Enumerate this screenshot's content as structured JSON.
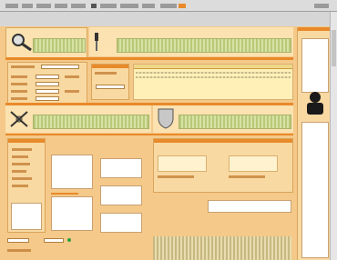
{
  "window": {
    "menu_items": [
      "",
      "",
      "",
      "",
      "",
      "",
      "",
      "",
      "",
      "",
      "",
      ""
    ]
  },
  "top_section": {
    "left_icon": "magnifier-icon",
    "right_icon": "tool-icon"
  },
  "middle_section": {
    "left_icon": "crossed-tools-icon",
    "right_icon": "shield-icon"
  },
  "right_panel": {
    "portrait_icon": "person-silhouette-icon"
  },
  "bottom_left": {
    "status_indicator_color": "#30a040"
  },
  "colors": {
    "background": "#f4c98a",
    "accent": "#e88a2a",
    "hatch_green": "#b9c97a",
    "status_green": "#30a040"
  }
}
